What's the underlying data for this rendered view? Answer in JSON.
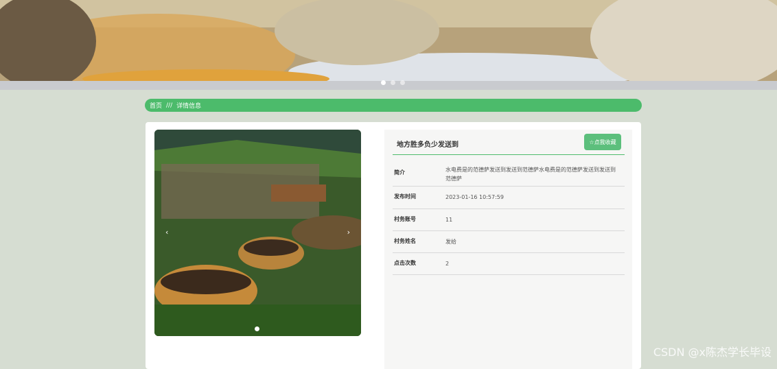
{
  "breadcrumb": {
    "home": "首页",
    "separator": "///",
    "current": "详情信息"
  },
  "detail": {
    "title": "地方胜多负少发送到",
    "favorite_button": "☆点我收藏",
    "rows": [
      {
        "label": "简介",
        "value": "水电费是的范德萨发送到发送到范德萨水电费是的范德萨发送到发送到范德萨"
      },
      {
        "label": "发布时间",
        "value": "2023-01-16 10:57:59"
      },
      {
        "label": "村务账号",
        "value": "11"
      },
      {
        "label": "村务姓名",
        "value": "发给"
      },
      {
        "label": "点击次数",
        "value": "2"
      }
    ]
  },
  "carousel": {
    "prev_icon": "‹",
    "next_icon": "›"
  },
  "watermark": "CSDN @x陈杰学长毕设"
}
